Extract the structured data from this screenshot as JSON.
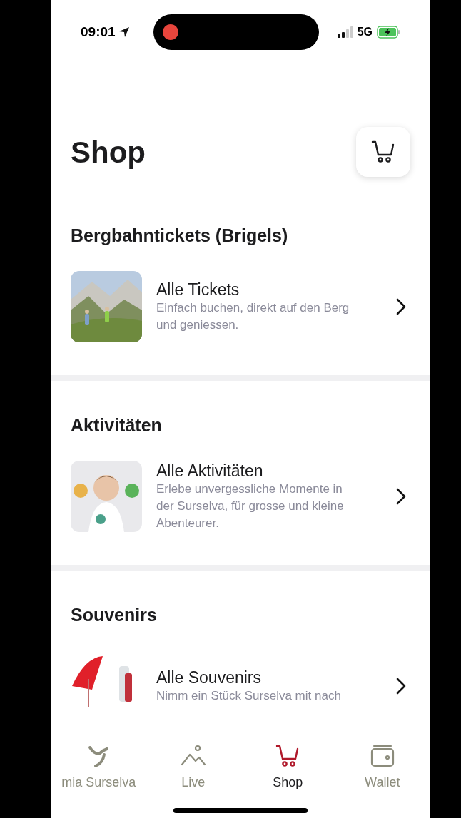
{
  "status_bar": {
    "time": "09:01",
    "network": "5G",
    "recording": true
  },
  "title": "Shop",
  "sections": [
    {
      "title": "Bergbahntickets (Brigels)",
      "items": [
        {
          "title": "Alle Tickets",
          "description": "Einfach buchen, direkt auf den Berg und geniessen.",
          "kind": "mountain"
        }
      ]
    },
    {
      "title": "Aktivitäten",
      "items": [
        {
          "title": "Alle Aktivitäten",
          "description": "Erlebe unvergessliche Momente in der Surselva, für grosse und kleine Abenteurer.",
          "kind": "child"
        }
      ]
    },
    {
      "title": "Souvenirs",
      "items": [
        {
          "title": "Alle Souvenirs",
          "description": "Nimm ein Stück Surselva mit nach",
          "kind": "souvenir"
        }
      ]
    }
  ],
  "tabs": [
    {
      "label": "mia Surselva",
      "kind": "logo",
      "selected": false
    },
    {
      "label": "Live",
      "kind": "mountain",
      "selected": false
    },
    {
      "label": "Shop",
      "kind": "cart",
      "selected": true
    },
    {
      "label": "Wallet",
      "kind": "wallet",
      "selected": false
    }
  ]
}
